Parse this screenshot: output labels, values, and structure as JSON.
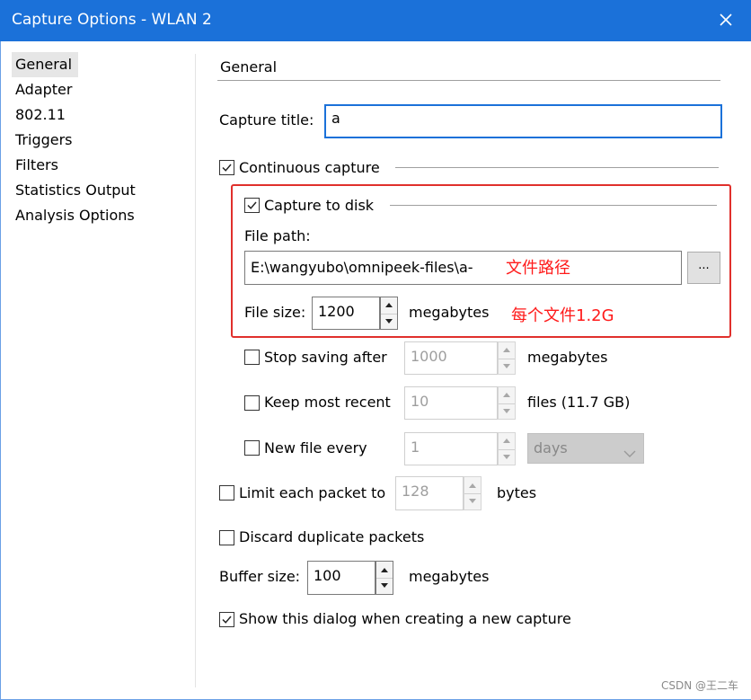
{
  "window": {
    "title": "Capture Options - WLAN 2"
  },
  "sidebar": {
    "items": [
      {
        "label": "General",
        "active": true
      },
      {
        "label": "Adapter"
      },
      {
        "label": "802.11"
      },
      {
        "label": "Triggers"
      },
      {
        "label": "Filters"
      },
      {
        "label": "Statistics Output"
      },
      {
        "label": "Analysis Options"
      }
    ]
  },
  "general": {
    "section_title": "General",
    "capture_title_label": "Capture title:",
    "capture_title_value": "a",
    "continuous_capture": {
      "label": "Continuous capture",
      "checked": true
    },
    "capture_to_disk": {
      "label": "Capture to disk",
      "checked": true
    },
    "file_path": {
      "label": "File path:",
      "value": "E:\\wangyubo\\omnipeek-files\\a-",
      "browse_label": "...",
      "annotation": "文件路径"
    },
    "file_size": {
      "label": "File size:",
      "value": "1200",
      "unit": "megabytes",
      "annotation": "每个文件1.2G"
    },
    "stop_saving": {
      "label": "Stop saving after",
      "checked": false,
      "value": "1000",
      "unit": "megabytes"
    },
    "keep_most_recent": {
      "label": "Keep most recent",
      "checked": false,
      "value": "10",
      "unit": "files (11.7 GB)"
    },
    "new_file_every": {
      "label": "New file every",
      "checked": false,
      "value": "1",
      "unit_selected": "days"
    },
    "limit_packet": {
      "label": "Limit each packet to",
      "checked": false,
      "value": "128",
      "unit": "bytes"
    },
    "discard_duplicates": {
      "label": "Discard duplicate packets",
      "checked": false
    },
    "buffer_size": {
      "label": "Buffer size:",
      "value": "100",
      "unit": "megabytes"
    },
    "show_dialog": {
      "label": "Show this dialog when creating a new capture",
      "checked": true
    }
  },
  "watermark": "CSDN @王二车"
}
